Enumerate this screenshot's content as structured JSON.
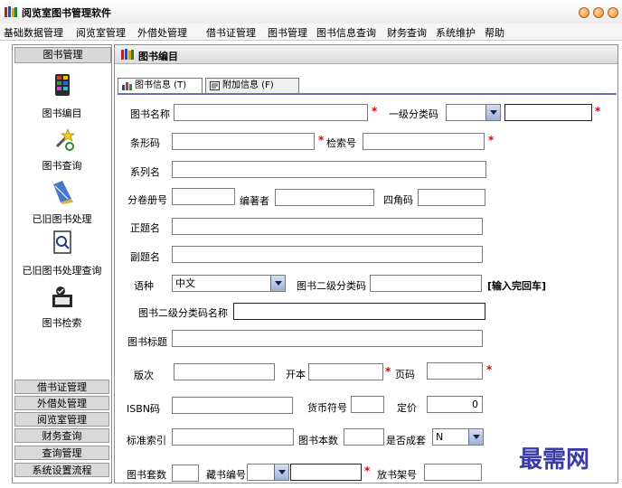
{
  "window": {
    "title": "阅览室图书管理软件",
    "icon": "books-icon",
    "controls_color": "#f08a2a"
  },
  "menu": [
    "基础数据管理",
    "阅览室管理",
    "外借处管理",
    "借书证管理",
    "图书管理",
    "图书信息查询",
    "财务查询",
    "系统维护",
    "帮助"
  ],
  "sidebar": {
    "header": "图书管理",
    "items": [
      {
        "label": "图书编目",
        "icon": "catalog-icon"
      },
      {
        "label": "图书查询",
        "icon": "magic-wand-icon"
      },
      {
        "label": "已旧图书处理",
        "icon": "broom-icon"
      },
      {
        "label": "已旧图书处理查询",
        "icon": "search-document-icon"
      },
      {
        "label": "图书检索",
        "icon": "retrieval-icon"
      }
    ],
    "categories": [
      "借书证管理",
      "外借处管理",
      "阅览室管理",
      "财务查询",
      "查询管理",
      "系统设置流程"
    ]
  },
  "main": {
    "title": "图书编目",
    "tabs": [
      {
        "label": "图书信息 (T)",
        "active": true
      },
      {
        "label": "附加信息 (F)",
        "active": false
      }
    ]
  },
  "form": {
    "book_name": {
      "label": "图书名称",
      "value": ""
    },
    "category1": {
      "label": "一级分类码",
      "value": ""
    },
    "barcode": {
      "label": "条形码",
      "value": ""
    },
    "search_no": {
      "label": "检索号",
      "value": ""
    },
    "series": {
      "label": "系列名",
      "value": ""
    },
    "volume": {
      "label": "分卷册号",
      "value": ""
    },
    "author": {
      "label": "编著者",
      "value": ""
    },
    "four_corner": {
      "label": "四角码",
      "value": ""
    },
    "main_title": {
      "label": "正题名",
      "value": ""
    },
    "sub_title": {
      "label": "副题名",
      "value": ""
    },
    "language": {
      "label": "语种",
      "value": "中文"
    },
    "category2": {
      "label": "图书二级分类码",
      "value": ""
    },
    "category2_hint": "[输入完回车]",
    "category2_name": {
      "label": "图书二级分类码名称",
      "value": ""
    },
    "book_subject": {
      "label": "图书标题",
      "value": ""
    },
    "edition": {
      "label": "版次",
      "value": ""
    },
    "format": {
      "label": "开本",
      "value": ""
    },
    "pages": {
      "label": "页码",
      "value": ""
    },
    "isbn": {
      "label": "ISBN码",
      "value": ""
    },
    "currency": {
      "label": "货币符号",
      "value": ""
    },
    "price": {
      "label": "定价",
      "value": "0"
    },
    "standard_index": {
      "label": "标准索引",
      "value": ""
    },
    "book_count": {
      "label": "图书本数",
      "value": ""
    },
    "is_set": {
      "label": "是否成套",
      "value": "N"
    },
    "set_count": {
      "label": "图书套数",
      "value": ""
    },
    "collection_no": {
      "label": "藏书编号",
      "value": ""
    },
    "shelf_no": {
      "label": "放书架号",
      "value": ""
    }
  },
  "required_color": "#dd0000",
  "watermark": "最需网"
}
